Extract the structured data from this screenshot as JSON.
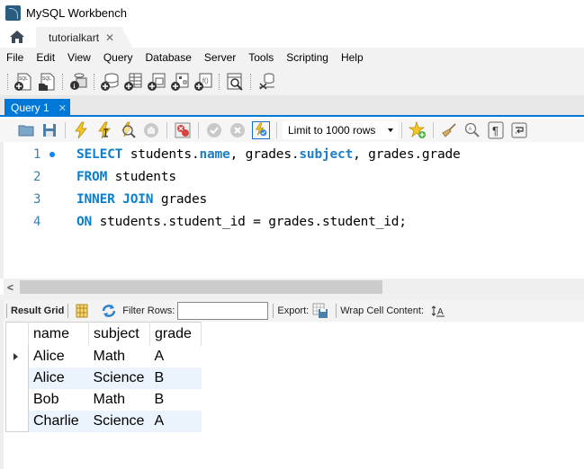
{
  "window": {
    "title": "MySQL Workbench"
  },
  "connection_tabs": [
    {
      "label": "tutorialkart",
      "close": "✕"
    }
  ],
  "menu": [
    "File",
    "Edit",
    "View",
    "Query",
    "Database",
    "Server",
    "Tools",
    "Scripting",
    "Help"
  ],
  "main_toolbar": {
    "icons": [
      "new-sql-tab-icon",
      "open-sql-script-icon",
      "inspector-icon",
      "create-schema-icon",
      "create-table-icon",
      "create-view-icon",
      "create-procedure-icon",
      "create-function-icon",
      "search-table-data-icon",
      "reconnect-icon"
    ]
  },
  "query_tab": {
    "label": "Query 1",
    "close": "✕"
  },
  "query_toolbar": {
    "limit_select": "Limit to 1000 rows"
  },
  "editor": {
    "lines": [
      {
        "num": "1",
        "marker": true,
        "tokens": [
          {
            "t": "SELECT",
            "c": "kw"
          },
          {
            "t": " students.",
            "c": ""
          },
          {
            "t": "name",
            "c": "fld"
          },
          {
            "t": ", grades.",
            "c": ""
          },
          {
            "t": "subject",
            "c": "fld"
          },
          {
            "t": ", grades.grade",
            "c": ""
          }
        ]
      },
      {
        "num": "2",
        "marker": false,
        "tokens": [
          {
            "t": "FROM",
            "c": "kw"
          },
          {
            "t": " students",
            "c": ""
          }
        ]
      },
      {
        "num": "3",
        "marker": false,
        "tokens": [
          {
            "t": "INNER JOIN",
            "c": "kw"
          },
          {
            "t": " grades",
            "c": ""
          }
        ]
      },
      {
        "num": "4",
        "marker": false,
        "tokens": [
          {
            "t": "ON",
            "c": "kw"
          },
          {
            "t": " students.student_id = grades.student_id;",
            "c": ""
          }
        ]
      }
    ]
  },
  "hscroll": {
    "left_arrow": "<"
  },
  "result_toolbar": {
    "result_grid": "Result Grid",
    "filter_rows": "Filter Rows:",
    "filter_value": "",
    "export": "Export:",
    "wrap_cell": "Wrap Cell Content:"
  },
  "result": {
    "columns": [
      "name",
      "subject",
      "grade"
    ],
    "rows": [
      [
        "Alice",
        "Math",
        "A"
      ],
      [
        "Alice",
        "Science",
        "B"
      ],
      [
        "Bob",
        "Math",
        "B"
      ],
      [
        "Charlie",
        "Science",
        "A"
      ]
    ]
  },
  "colors": {
    "accent": "#0078d7",
    "keyword": "#0a7fce",
    "alt_row": "#ebf3fd"
  }
}
